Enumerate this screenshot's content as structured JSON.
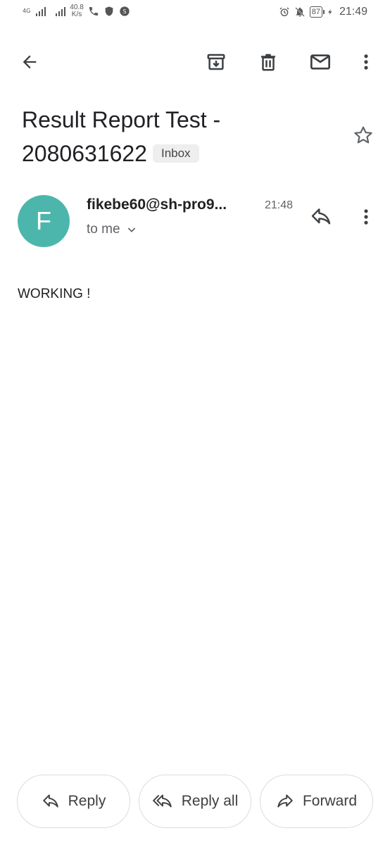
{
  "status_bar": {
    "network_label": "4G",
    "speed_value": "40.8",
    "speed_unit": "K/s",
    "battery": "87",
    "time": "21:49"
  },
  "appbar": {
    "icons": [
      "back-arrow-icon",
      "archive-icon",
      "delete-icon",
      "mark-unread-icon",
      "more-vert-icon"
    ]
  },
  "email": {
    "subject": "Result Report Test - 2080631622",
    "label": "Inbox",
    "avatar_letter": "F",
    "avatar_color": "#4db6ac",
    "sender": "fikebe60@sh-pro9...",
    "time": "21:48",
    "recipient": "to me",
    "body": "WORKING !"
  },
  "actions": {
    "reply": "Reply",
    "reply_all": "Reply all",
    "forward": "Forward"
  }
}
